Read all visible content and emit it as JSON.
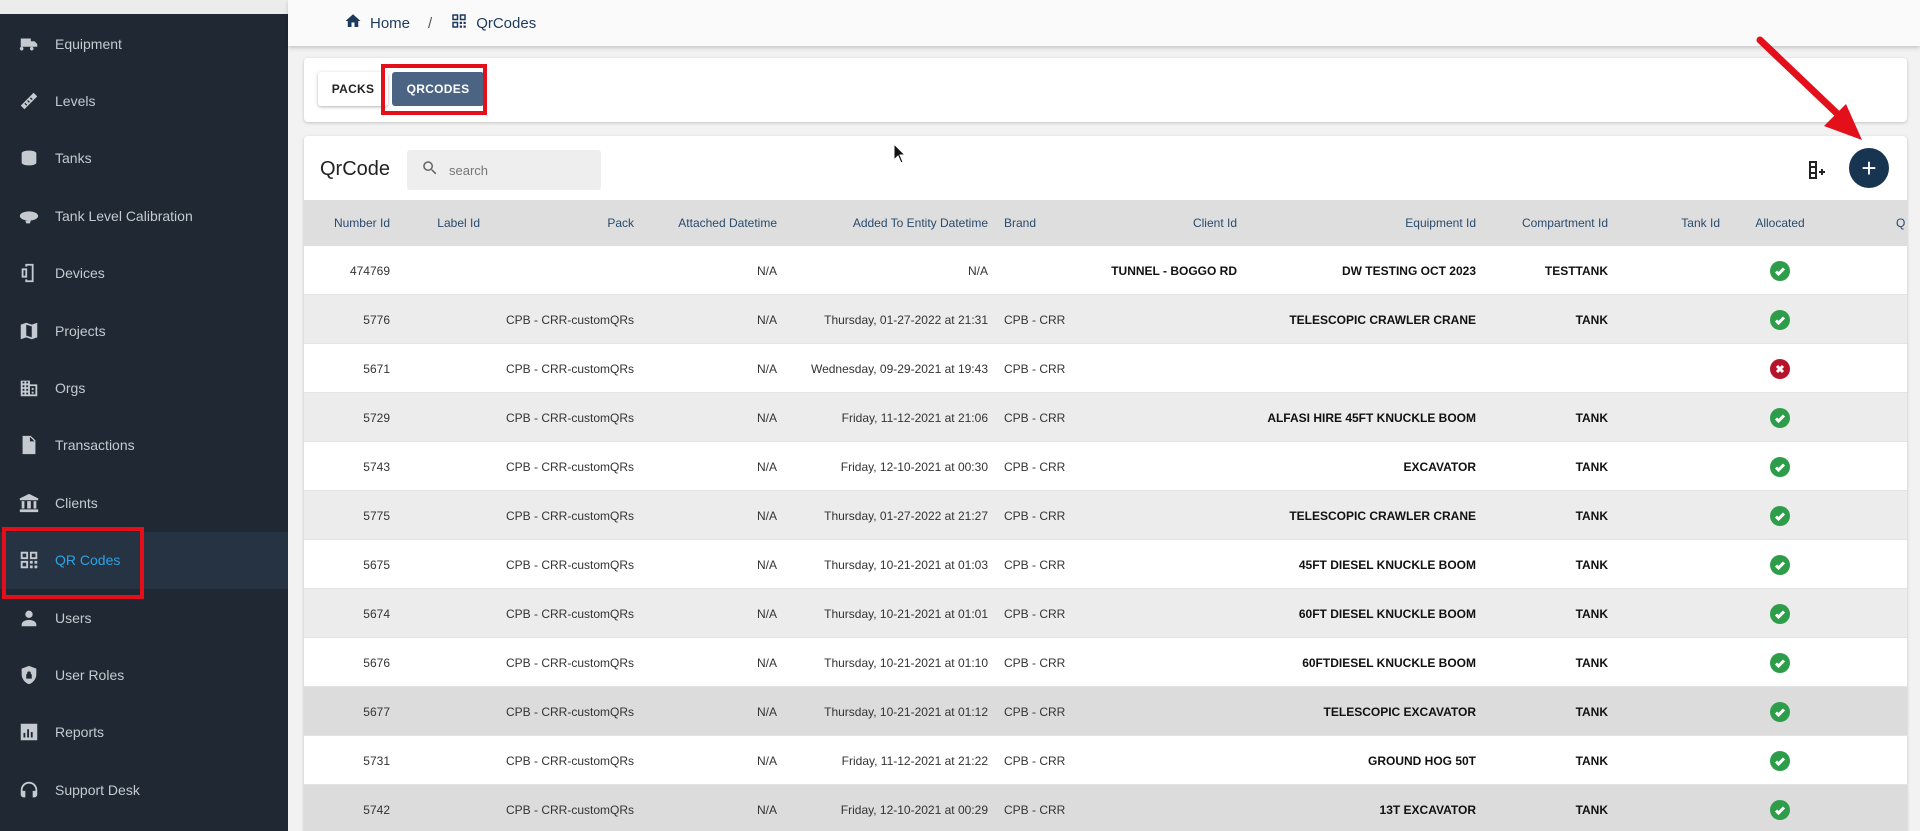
{
  "sidebar": {
    "items": [
      {
        "label": "Equipment",
        "icon": "truck-icon"
      },
      {
        "label": "Levels",
        "icon": "ruler-icon"
      },
      {
        "label": "Tanks",
        "icon": "tank-icon"
      },
      {
        "label": "Tank Level Calibration",
        "icon": "blimp-icon"
      },
      {
        "label": "Devices",
        "icon": "device-icon"
      },
      {
        "label": "Projects",
        "icon": "map-icon"
      },
      {
        "label": "Orgs",
        "icon": "building-icon"
      },
      {
        "label": "Transactions",
        "icon": "document-icon"
      },
      {
        "label": "Clients",
        "icon": "bank-icon"
      },
      {
        "label": "QR Codes",
        "icon": "qr-icon"
      },
      {
        "label": "Users",
        "icon": "person-icon"
      },
      {
        "label": "User Roles",
        "icon": "shield-icon"
      },
      {
        "label": "Reports",
        "icon": "chart-icon"
      },
      {
        "label": "Support Desk",
        "icon": "support-icon"
      }
    ],
    "active": "QR Codes"
  },
  "breadcrumb": {
    "home": "Home",
    "separator": "/",
    "current": "QrCodes"
  },
  "tabs": {
    "packs": "PACKS",
    "qrcodes": "QRCODES"
  },
  "table": {
    "title": "QrCode",
    "search_placeholder": "search",
    "add_label": "+",
    "columns": [
      "Number Id",
      "Label Id",
      "Pack",
      "Attached Datetime",
      "Added To Entity Datetime",
      "Brand",
      "Client Id",
      "Equipment Id",
      "Compartment Id",
      "Tank Id",
      "Allocated",
      "Q"
    ],
    "rows": [
      {
        "number_id": "474769",
        "label_id": "",
        "pack": "",
        "attached": "N/A",
        "added": "N/A",
        "brand": "",
        "client": "TUNNEL - BOGGO RD",
        "equipment": "DW TESTING OCT 2023",
        "compartment": "TESTTANK",
        "tank": "",
        "allocated": true
      },
      {
        "number_id": "5776",
        "label_id": "",
        "pack": "CPB - CRR-customQRs",
        "attached": "N/A",
        "added": "Thursday, 01-27-2022 at 21:31",
        "brand": "CPB - CRR",
        "client": "",
        "equipment": "TELESCOPIC CRAWLER CRANE",
        "compartment": "TANK",
        "tank": "",
        "allocated": true
      },
      {
        "number_id": "5671",
        "label_id": "",
        "pack": "CPB - CRR-customQRs",
        "attached": "N/A",
        "added": "Wednesday, 09-29-2021 at 19:43",
        "brand": "CPB - CRR",
        "client": "",
        "equipment": "",
        "compartment": "",
        "tank": "",
        "allocated": false
      },
      {
        "number_id": "5729",
        "label_id": "",
        "pack": "CPB - CRR-customQRs",
        "attached": "N/A",
        "added": "Friday, 11-12-2021 at 21:06",
        "brand": "CPB - CRR",
        "client": "",
        "equipment": "ALFASI HIRE 45FT KNUCKLE BOOM",
        "compartment": "TANK",
        "tank": "",
        "allocated": true
      },
      {
        "number_id": "5743",
        "label_id": "",
        "pack": "CPB - CRR-customQRs",
        "attached": "N/A",
        "added": "Friday, 12-10-2021 at 00:30",
        "brand": "CPB - CRR",
        "client": "",
        "equipment": "EXCAVATOR",
        "compartment": "TANK",
        "tank": "",
        "allocated": true
      },
      {
        "number_id": "5775",
        "label_id": "",
        "pack": "CPB - CRR-customQRs",
        "attached": "N/A",
        "added": "Thursday, 01-27-2022 at 21:27",
        "brand": "CPB - CRR",
        "client": "",
        "equipment": "TELESCOPIC CRAWLER CRANE",
        "compartment": "TANK",
        "tank": "",
        "allocated": true
      },
      {
        "number_id": "5675",
        "label_id": "",
        "pack": "CPB - CRR-customQRs",
        "attached": "N/A",
        "added": "Thursday, 10-21-2021 at 01:03",
        "brand": "CPB - CRR",
        "client": "",
        "equipment": "45FT DIESEL KNUCKLE BOOM",
        "compartment": "TANK",
        "tank": "",
        "allocated": true
      },
      {
        "number_id": "5674",
        "label_id": "",
        "pack": "CPB - CRR-customQRs",
        "attached": "N/A",
        "added": "Thursday, 10-21-2021 at 01:01",
        "brand": "CPB - CRR",
        "client": "",
        "equipment": "60FT DIESEL KNUCKLE BOOM",
        "compartment": "TANK",
        "tank": "",
        "allocated": true
      },
      {
        "number_id": "5676",
        "label_id": "",
        "pack": "CPB - CRR-customQRs",
        "attached": "N/A",
        "added": "Thursday, 10-21-2021 at 01:10",
        "brand": "CPB - CRR",
        "client": "",
        "equipment": "60FTDIESEL KNUCKLE BOOM",
        "compartment": "TANK",
        "tank": "",
        "allocated": true
      },
      {
        "number_id": "5677",
        "label_id": "",
        "pack": "CPB - CRR-customQRs",
        "attached": "N/A",
        "added": "Thursday, 10-21-2021 at 01:12",
        "brand": "CPB - CRR",
        "client": "",
        "equipment": "TELESCOPIC EXCAVATOR",
        "compartment": "TANK",
        "tank": "",
        "allocated": true
      },
      {
        "number_id": "5731",
        "label_id": "",
        "pack": "CPB - CRR-customQRs",
        "attached": "N/A",
        "added": "Friday, 11-12-2021 at 21:22",
        "brand": "CPB - CRR",
        "client": "",
        "equipment": "GROUND HOG 50T",
        "compartment": "TANK",
        "tank": "",
        "allocated": true
      },
      {
        "number_id": "5742",
        "label_id": "",
        "pack": "CPB - CRR-customQRs",
        "attached": "N/A",
        "added": "Friday, 12-10-2021 at 00:29",
        "brand": "CPB - CRR",
        "client": "",
        "equipment": "13T EXCAVATOR",
        "compartment": "TANK",
        "tank": "",
        "allocated": true
      }
    ]
  },
  "colors": {
    "sidebar_bg": "#1f2833",
    "active_text": "#2aa3e5",
    "highlight": "#e3101b",
    "primary": "#173451",
    "ok": "#2e9d4a",
    "error": "#b5142a"
  }
}
